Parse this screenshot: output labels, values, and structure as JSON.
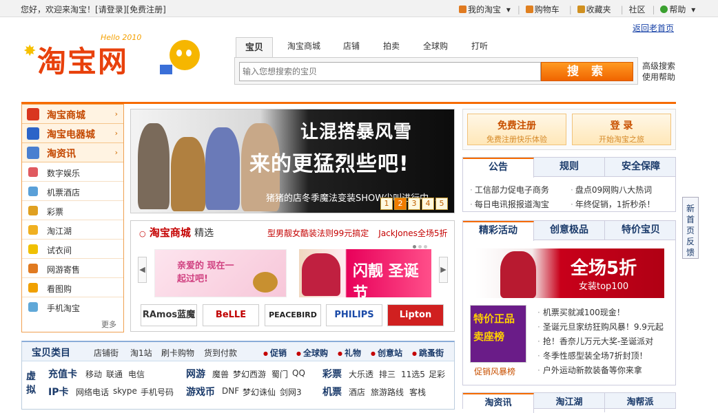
{
  "topbar": {
    "greeting": "您好，欢迎来淘宝！",
    "login": "[请登录]",
    "register": "[免费注册]",
    "my_taobao": "我的淘宝",
    "cart": "购物车",
    "favorites": "收藏夹",
    "community": "社区",
    "help": "帮助"
  },
  "header": {
    "logo_text": "淘宝网",
    "logo_tag": "Hello 2010",
    "back_old": "返回老首页"
  },
  "search": {
    "tabs": [
      "宝贝",
      "淘宝商城",
      "店铺",
      "拍卖",
      "全球购",
      "打听"
    ],
    "placeholder": "输入您想搜索的宝贝",
    "button": "搜 索",
    "advanced": "高级搜索",
    "help": "使用帮助"
  },
  "leftnav": {
    "big": [
      {
        "label": "淘宝商城",
        "color": "#d9361f"
      },
      {
        "label": "淘宝电器城",
        "color": "#2c64c8"
      },
      {
        "label": "淘资讯",
        "color": "#4a7fd0"
      }
    ],
    "items": [
      {
        "label": "数字娱乐",
        "color": "#e05a60"
      },
      {
        "label": "机票酒店",
        "color": "#5aa0d8"
      },
      {
        "label": "彩票",
        "color": "#e0a020"
      },
      {
        "label": "淘江湖",
        "color": "#f0b020"
      },
      {
        "label": "试衣间",
        "color": "#f0c000"
      },
      {
        "label": "网游寄售",
        "color": "#e07a20"
      },
      {
        "label": "看图购",
        "color": "#f0a000"
      },
      {
        "label": "手机淘宝",
        "color": "#60a8d8"
      }
    ],
    "more": "更多"
  },
  "banner": {
    "line1": "让混搭暴风雪",
    "line2": "来的更猛烈些吧!",
    "line3": "猪猪的店冬季魔法变装SHOW尖叫进行中...",
    "pages": [
      "1",
      "2",
      "3",
      "4",
      "5"
    ],
    "active_page": 2
  },
  "mall": {
    "title": "淘宝商城",
    "subtitle": "精选",
    "links": [
      "型男靓女酷装法则99元搞定",
      "JackJones全场5折"
    ],
    "promo1_text": "亲爱的 现在一起过吧!",
    "promo2_text": "闪靓 圣诞节",
    "brands": [
      "RAmos蓝魔",
      "BeLLE",
      "PEACEBIRD",
      "PHILIPS",
      "Lipton"
    ]
  },
  "login_box": {
    "register_title": "免费注册",
    "register_sub": "免费注册快乐体验",
    "login_title": "登 录",
    "login_sub": "开始淘宝之旅"
  },
  "news": {
    "tabs": [
      "公告",
      "规则",
      "安全保障"
    ],
    "items": [
      "工信部力促电子商务",
      "盘点09网购八大热词",
      "每日电讯报报道淘宝",
      "年终促销，1折秒杀！"
    ]
  },
  "activities": {
    "tabs": [
      "精彩活动",
      "创意极品",
      "特价宝贝"
    ],
    "banner_text": "全场5折",
    "banner_sub": "女装top100",
    "card_text": "特价正品 卖座榜",
    "card_caption": "促销风暴榜",
    "list": [
      "机票买就减100现金！",
      "圣诞元旦家纺狂购风暴！9.9元起",
      "抢！香奈儿万元大奖-圣诞派对",
      "冬季性感型装全场7折封顶！",
      "户外运动新款装备等你来拿"
    ]
  },
  "feedback": "新首页反馈",
  "category": {
    "title": "宝贝类目",
    "head_links": [
      "店铺街",
      "淘1站",
      "刷卡购物",
      "货到付款"
    ],
    "head_right": [
      "促销",
      "全球购",
      "礼物",
      "创意站",
      "跳蚤街"
    ],
    "virtual_label": "虚拟",
    "groups": [
      {
        "name": "充值卡",
        "items": [
          "移动",
          "联通",
          "电信"
        ]
      },
      {
        "name": "网游",
        "items": [
          "魔兽",
          "梦幻西游",
          "蜀门",
          "QQ"
        ]
      },
      {
        "name": "彩票",
        "items": [
          "大乐透",
          "排三",
          "11选5",
          "足彩"
        ]
      },
      {
        "name": "IP卡",
        "items": [
          "网络电话",
          "skype",
          "手机号码"
        ]
      },
      {
        "name": "游戏币",
        "items": [
          "DNF",
          "梦幻诛仙",
          "剑网3"
        ]
      },
      {
        "name": "机票",
        "items": [
          "酒店",
          "旅游路线",
          "客栈"
        ]
      }
    ]
  },
  "bottom_tabs": [
    "淘资讯",
    "淘江湖",
    "淘帮派"
  ]
}
